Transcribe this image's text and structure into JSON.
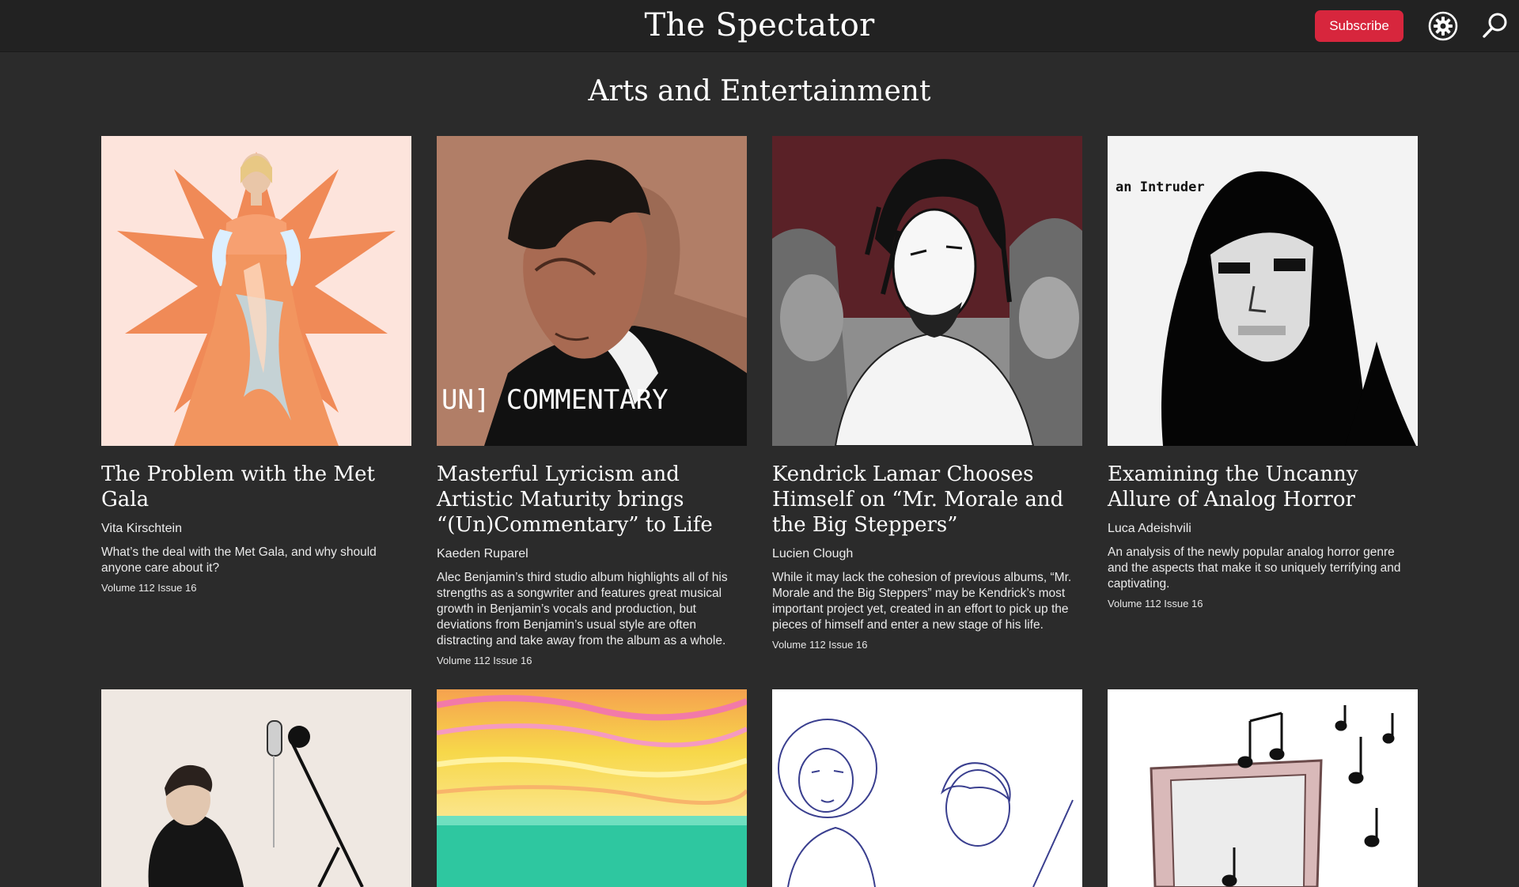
{
  "header": {
    "site_title": "The Spectator",
    "subscribe_label": "Subscribe",
    "settings_icon": "gear-icon",
    "search_icon": "search-icon",
    "accent_color": "#d7263d"
  },
  "section": {
    "title": "Arts and Entertainment"
  },
  "articles": [
    {
      "title": "The Problem with the Met Gala",
      "author": "Vita Kirschtein",
      "description": "What’s the deal with the Met Gala, and why should anyone care about it?",
      "issue": "Volume 112 Issue 16"
    },
    {
      "title": "Masterful Lyricism and Artistic Maturity brings “(Un)Commentary” to Life",
      "author": "Kaeden Ruparel",
      "description": "Alec Benjamin’s third studio album highlights all of his strengths as a songwriter and features great musical growth in Benjamin’s vocals and production, but deviations from Benjamin’s usual style are often distracting and take away from the album as a whole.",
      "issue": "Volume 112 Issue 16",
      "image_text": "UN] COMMENTARY"
    },
    {
      "title": "Kendrick Lamar Chooses Himself on “Mr. Morale and the Big Steppers”",
      "author": "Lucien Clough",
      "description": "While it may lack the cohesion of previous albums, “Mr. Morale and the Big Steppers” may be Kendrick’s most important project yet, created in an effort to pick up the pieces of himself and enter a new stage of his life.",
      "issue": "Volume 112 Issue 16"
    },
    {
      "title": "Examining the Uncanny Allure of Analog Horror",
      "author": "Luca Adeishvili",
      "description": "An analysis of the newly popular analog horror genre and the aspects that make it so uniquely terrifying and captivating.",
      "issue": "Volume 112 Issue 16",
      "image_text": "an Intruder"
    }
  ]
}
